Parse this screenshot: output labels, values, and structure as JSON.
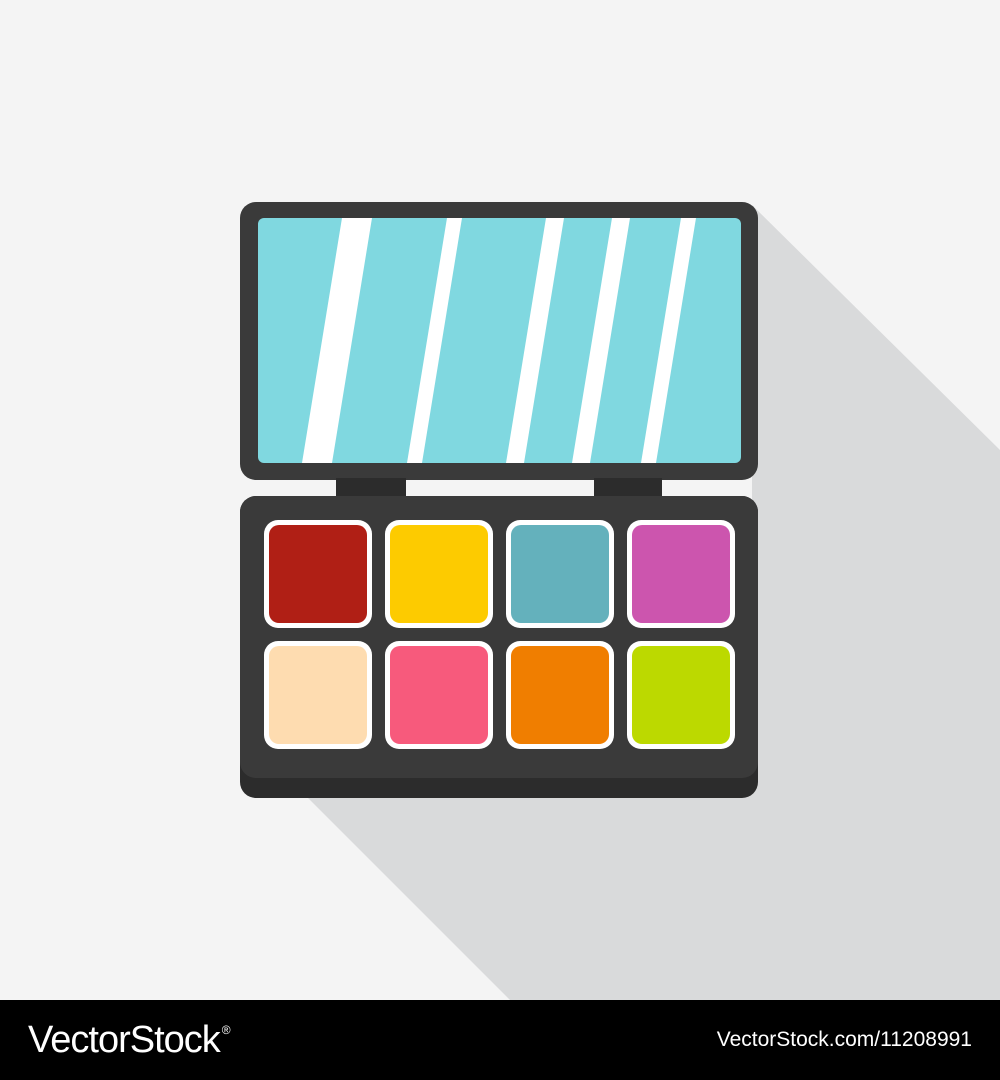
{
  "icon": {
    "name": "eyeshadow-palette-icon",
    "colors": {
      "background": "#f4f4f4",
      "shadow": "#d9dadb",
      "case": "#3a3a3a",
      "case_dark": "#2c2c2c",
      "mirror": "#80d8e0",
      "mirror_glare": "#ffffff",
      "pan_border": "#ffffff"
    },
    "pans": [
      {
        "color": "#b01f15"
      },
      {
        "color": "#fdcb00"
      },
      {
        "color": "#64b1bc"
      },
      {
        "color": "#cc55ae"
      },
      {
        "color": "#fedcb0"
      },
      {
        "color": "#f75a7c"
      },
      {
        "color": "#f07e00"
      },
      {
        "color": "#bcd900"
      }
    ]
  },
  "footer": {
    "brand": "VectorStock",
    "registered": "®",
    "image_id": "VectorStock.com/11208991"
  }
}
